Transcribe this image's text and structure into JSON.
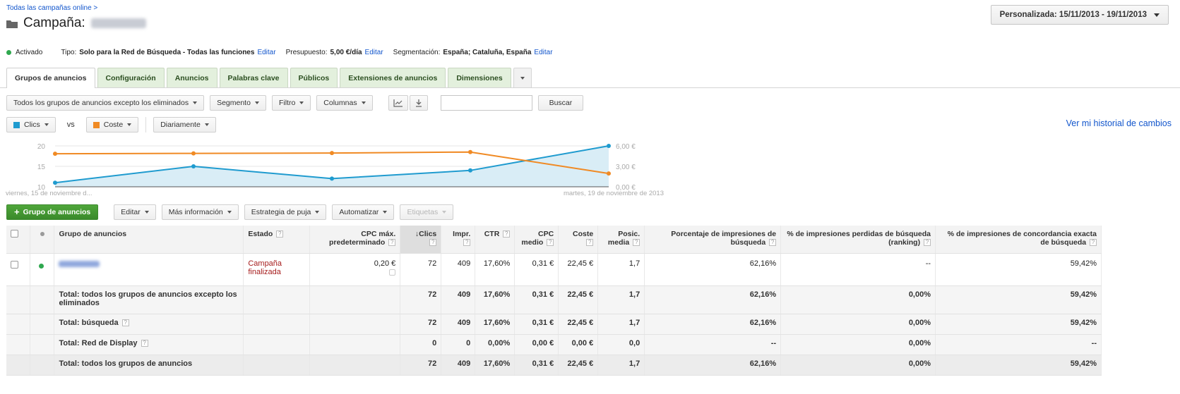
{
  "header": {
    "breadcrumb": "Todas las campañas online >",
    "campaign_label": "Campaña:",
    "date_range": "Personalizada: 15/11/2013 - 19/11/2013"
  },
  "status_line": {
    "status": "Activado",
    "type_label": "Tipo:",
    "type_value": "Solo para la Red de Búsqueda - Todas las funciones",
    "edit1": "Editar",
    "budget_label": "Presupuesto:",
    "budget_value": "5,00 €/día",
    "edit2": "Editar",
    "targeting_label": "Segmentación:",
    "targeting_value": "España; Cataluña, España",
    "edit3": "Editar"
  },
  "tabs": [
    {
      "label": "Grupos de anuncios"
    },
    {
      "label": "Configuración"
    },
    {
      "label": "Anuncios"
    },
    {
      "label": "Palabras clave"
    },
    {
      "label": "Públicos"
    },
    {
      "label": "Extensiones de anuncios"
    },
    {
      "label": "Dimensiones"
    }
  ],
  "toolbar": {
    "filter_select": "Todos los grupos de anuncios excepto los eliminados",
    "segment": "Segmento",
    "filter": "Filtro",
    "columns": "Columnas",
    "search_button": "Buscar",
    "metric1": "Clics",
    "vs": "vs",
    "metric2": "Coste",
    "period": "Diariamente",
    "history_link": "Ver mi historial de cambios"
  },
  "colors": {
    "clics": "#1f9bcf",
    "coste": "#f08a24",
    "tab_green": "#e3f0dd"
  },
  "chart_data": {
    "type": "line",
    "x": [
      "2013-11-15",
      "2013-11-16",
      "2013-11-17",
      "2013-11-18",
      "2013-11-19"
    ],
    "x_start_label": "viernes, 15 de noviembre d...",
    "x_end_label": "martes, 19 de noviembre de 2013",
    "left_axis": {
      "ticks": [
        "20",
        "15",
        "10"
      ],
      "range": [
        10,
        20
      ]
    },
    "right_axis": {
      "ticks": [
        "6,00 €",
        "3,00 €",
        "0,00 €"
      ],
      "range": [
        0,
        6
      ]
    },
    "series": [
      {
        "name": "Clics",
        "axis": "left",
        "values": [
          11,
          15,
          12,
          14,
          20
        ]
      },
      {
        "name": "Coste",
        "axis": "right",
        "values": [
          4.85,
          4.9,
          4.95,
          5.1,
          1.95
        ]
      }
    ]
  },
  "actions": {
    "add_group": "Grupo de anuncios",
    "edit": "Editar",
    "more_info": "Más información",
    "bid_strategy": "Estrategia de puja",
    "automate": "Automatizar",
    "labels": "Etiquetas"
  },
  "table": {
    "headers": {
      "group": "Grupo de anuncios",
      "state": "Estado",
      "cpc_max": "CPC máx. predeterminado",
      "clicks": "Clics",
      "impr": "Impr.",
      "ctr": "CTR",
      "cpc_avg": "CPC medio",
      "cost": "Coste",
      "pos": "Posic. media",
      "impr_share": "Porcentaje de impresiones de búsqueda",
      "lost_rank": "% de impresiones perdidas de búsqueda (ranking)",
      "exact_share": "% de impresiones de concordancia exacta de búsqueda"
    },
    "row": {
      "state": "Campaña finalizada",
      "cpc_max": "0,20 €",
      "clicks": "72",
      "impr": "409",
      "ctr": "17,60%",
      "cpc_avg": "0,31 €",
      "cost": "22,45 €",
      "pos": "1,7",
      "impr_share": "62,16%",
      "lost_rank": "--",
      "exact_share": "59,42%"
    },
    "totals": [
      {
        "label": "Total: todos los grupos de anuncios excepto los eliminados",
        "clicks": "72",
        "impr": "409",
        "ctr": "17,60%",
        "cpc_avg": "0,31 €",
        "cost": "22,45 €",
        "pos": "1,7",
        "impr_share": "62,16%",
        "lost_rank": "0,00%",
        "exact_share": "59,42%"
      },
      {
        "label": "Total: búsqueda",
        "clicks": "72",
        "impr": "409",
        "ctr": "17,60%",
        "cpc_avg": "0,31 €",
        "cost": "22,45 €",
        "pos": "1,7",
        "impr_share": "62,16%",
        "lost_rank": "0,00%",
        "exact_share": "59,42%"
      },
      {
        "label": "Total: Red de Display",
        "clicks": "0",
        "impr": "0",
        "ctr": "0,00%",
        "cpc_avg": "0,00 €",
        "cost": "0,00 €",
        "pos": "0,0",
        "impr_share": "--",
        "lost_rank": "0,00%",
        "exact_share": "--"
      },
      {
        "label": "Total: todos los grupos de anuncios",
        "clicks": "72",
        "impr": "409",
        "ctr": "17,60%",
        "cpc_avg": "0,31 €",
        "cost": "22,45 €",
        "pos": "1,7",
        "impr_share": "62,16%",
        "lost_rank": "0,00%",
        "exact_share": "59,42%"
      }
    ]
  }
}
